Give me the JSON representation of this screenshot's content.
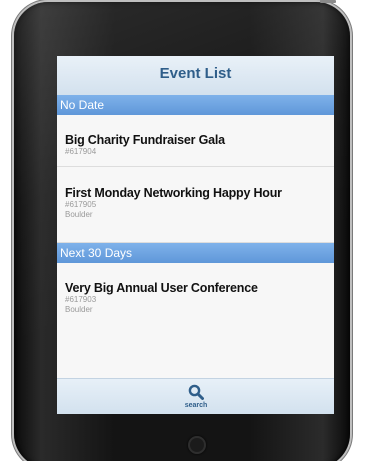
{
  "header": {
    "title": "Event List"
  },
  "sections": [
    {
      "label": "No Date",
      "items": [
        {
          "title": "Big Charity Fundraiser Gala",
          "id": "#617904",
          "location": ""
        },
        {
          "title": "First Monday Networking Happy Hour",
          "id": "#617905",
          "location": "Boulder"
        }
      ]
    },
    {
      "label": "Next 30 Days",
      "items": [
        {
          "title": "Very Big Annual User Conference",
          "id": "#617903",
          "location": "Boulder"
        }
      ]
    }
  ],
  "footer": {
    "search_label": "search",
    "search_icon": "search-icon"
  },
  "colors": {
    "header_text": "#2f5e8a",
    "section_bar": "#6fa5e2",
    "device_frame": "#141414"
  }
}
